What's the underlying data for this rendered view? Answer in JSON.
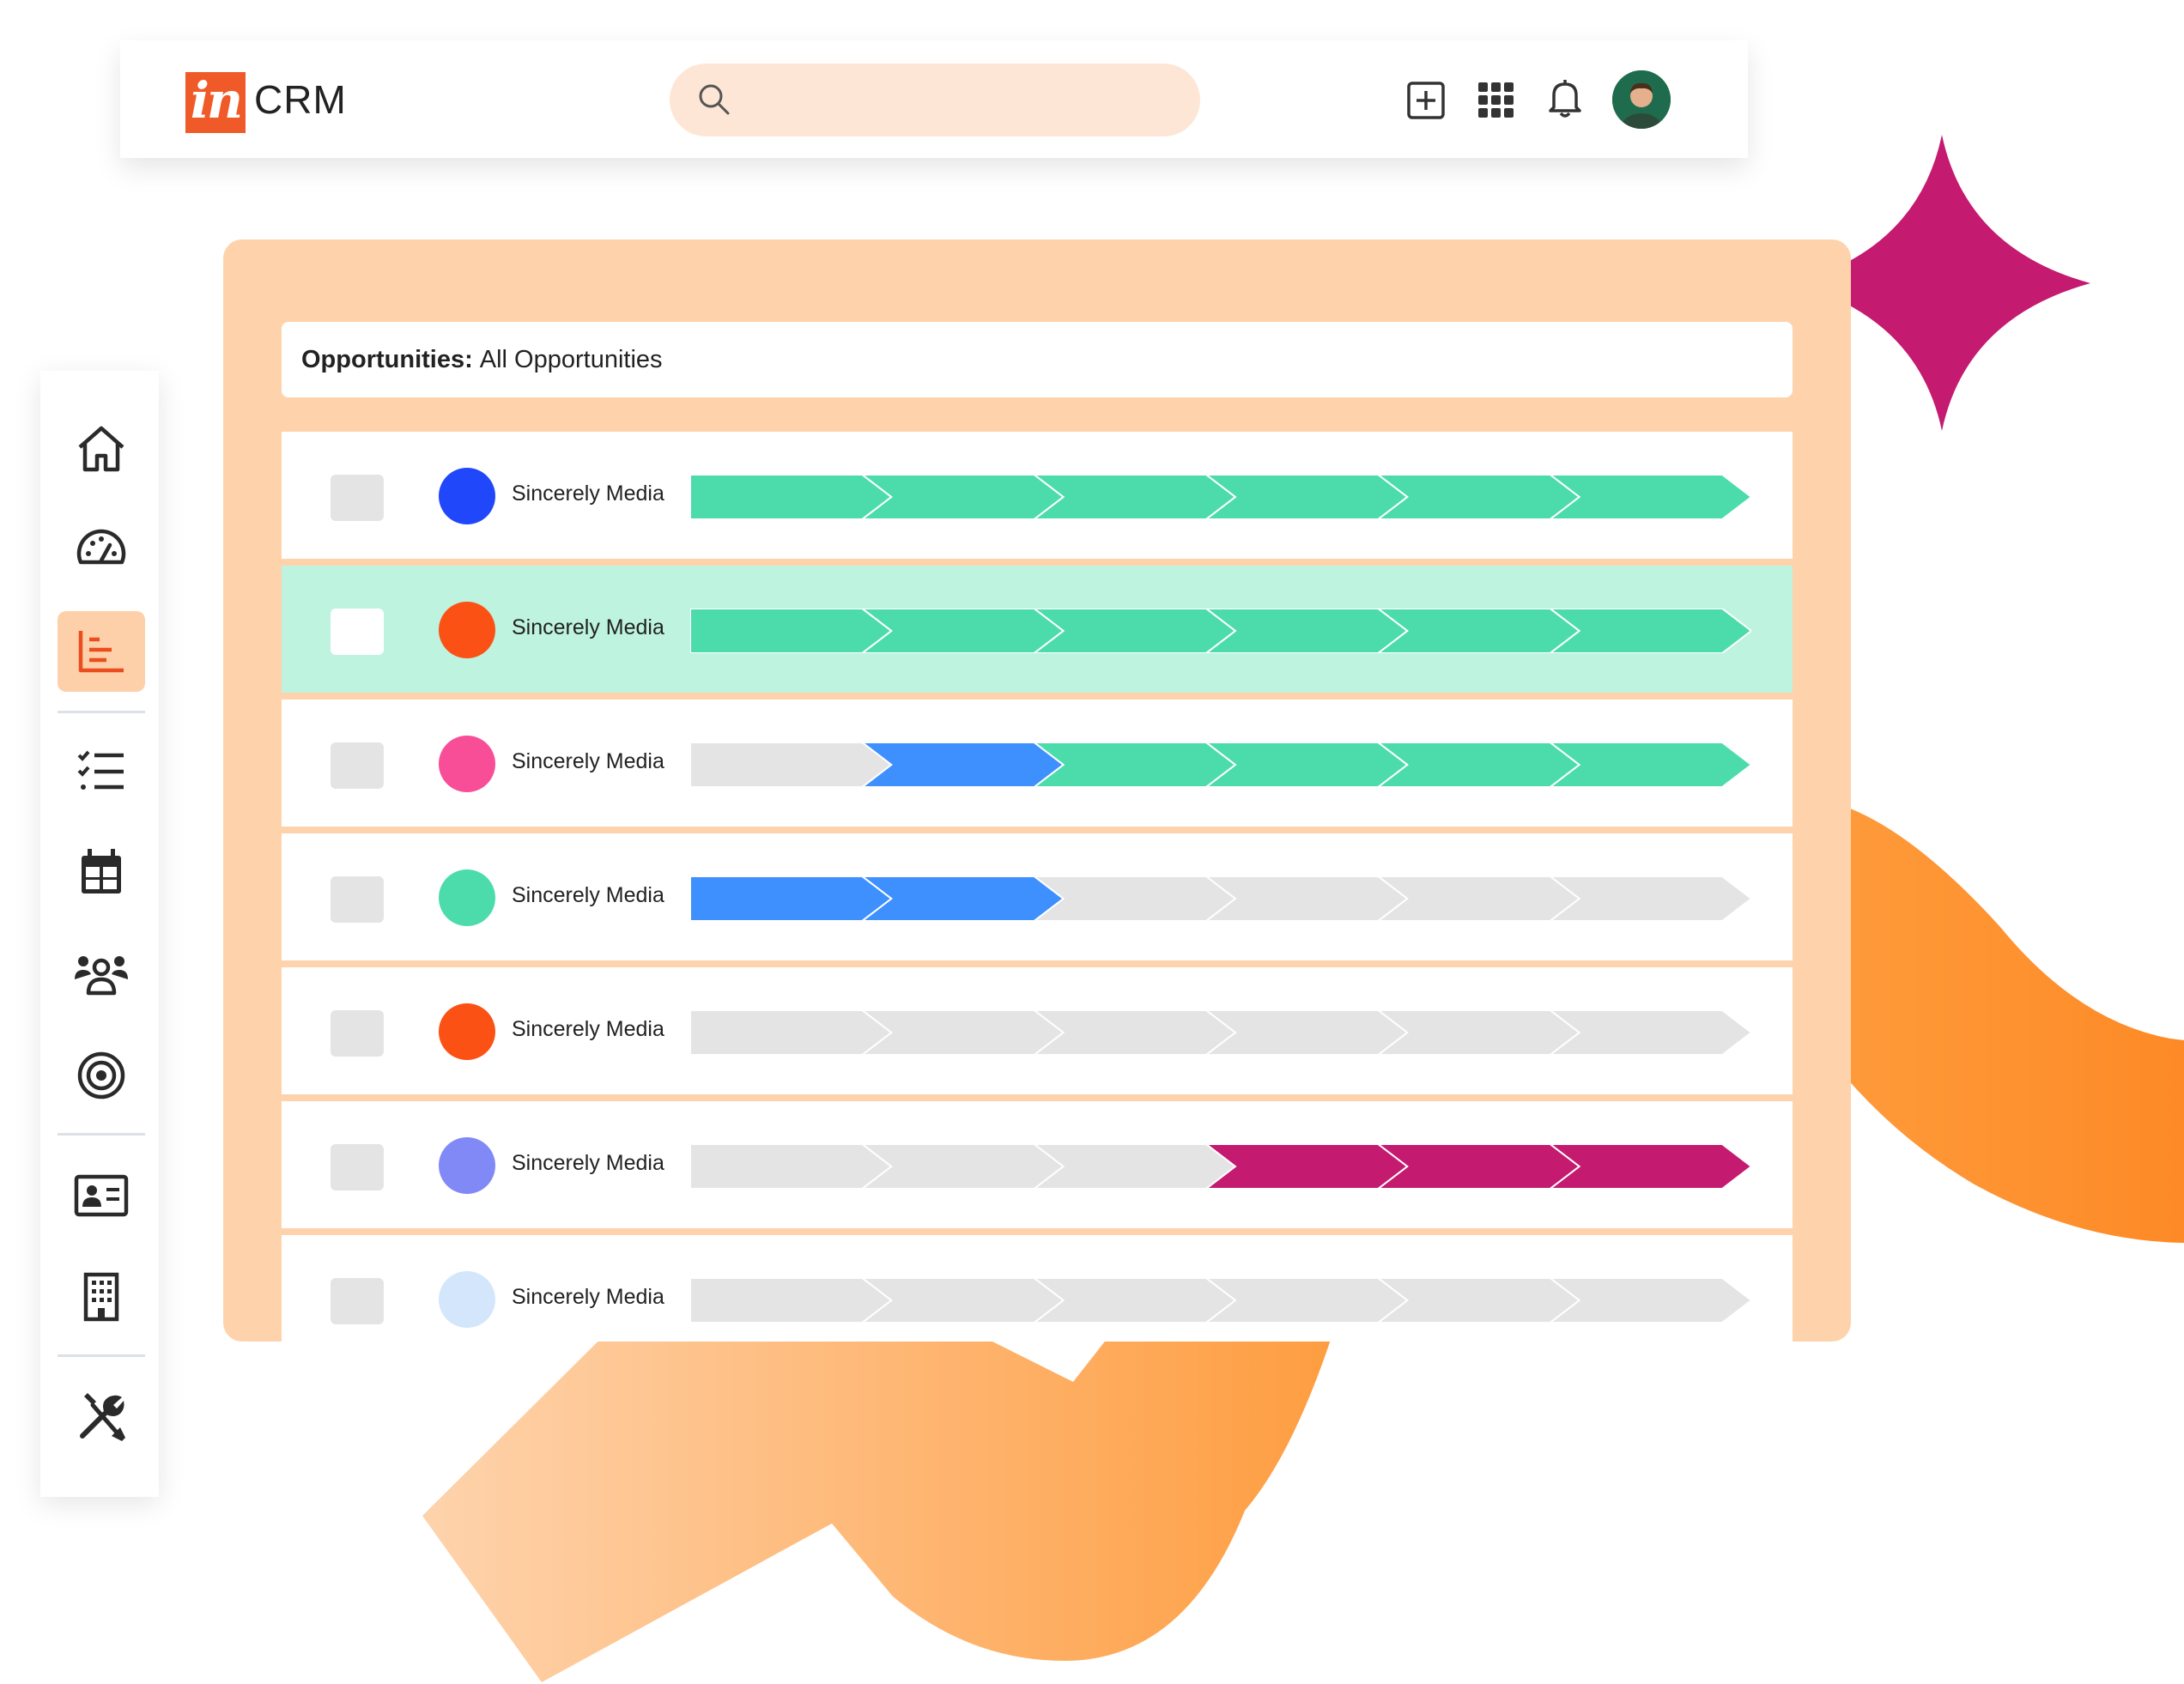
{
  "app": {
    "logo_badge": "in",
    "logo_text": "CRM",
    "brand_color": "#f05a28"
  },
  "search": {
    "placeholder": "",
    "value": "",
    "icon": "search-icon"
  },
  "toolbar_icons": [
    "add-icon",
    "apps-grid-icon",
    "bell-icon",
    "user-avatar"
  ],
  "sidebar": {
    "items": [
      {
        "icon": "home-icon",
        "active": false
      },
      {
        "icon": "dashboard-gauge-icon",
        "active": false
      },
      {
        "icon": "opportunities-chart-icon",
        "active": true
      },
      {
        "icon": "tasks-checklist-icon",
        "active": false
      },
      {
        "icon": "calendar-icon",
        "active": false
      },
      {
        "icon": "people-icon",
        "active": false
      },
      {
        "icon": "target-icon",
        "active": false
      },
      {
        "icon": "contact-card-icon",
        "active": false
      },
      {
        "icon": "company-building-icon",
        "active": false
      },
      {
        "icon": "tools-icon",
        "active": false
      }
    ]
  },
  "view": {
    "label": "Opportunities:",
    "value": "All Opportunities"
  },
  "pipeline_colors": {
    "empty": "#e4e4e4",
    "won": "#4cdcac",
    "progress": "#3d90fd",
    "lost": "#c41a6f"
  },
  "rows": [
    {
      "name": "Sincerely Media",
      "color": "#2147fb",
      "selected": false,
      "stages": [
        "won",
        "won",
        "won",
        "won",
        "won",
        "won"
      ]
    },
    {
      "name": "Sincerely Media",
      "color": "#fb5114",
      "selected": true,
      "stages": [
        "won",
        "won",
        "won",
        "won",
        "won",
        "won"
      ]
    },
    {
      "name": "Sincerely Media",
      "color": "#f84e98",
      "selected": false,
      "stages": [
        "empty",
        "progress",
        "won",
        "won",
        "won",
        "won"
      ]
    },
    {
      "name": "Sincerely Media",
      "color": "#4cdcac",
      "selected": false,
      "stages": [
        "progress",
        "progress",
        "empty",
        "empty",
        "empty",
        "empty"
      ]
    },
    {
      "name": "Sincerely Media",
      "color": "#fb5114",
      "selected": false,
      "stages": [
        "empty",
        "empty",
        "empty",
        "empty",
        "empty",
        "empty"
      ]
    },
    {
      "name": "Sincerely Media",
      "color": "#8189f7",
      "selected": false,
      "stages": [
        "empty",
        "empty",
        "empty",
        "lost",
        "lost",
        "lost"
      ]
    },
    {
      "name": "Sincerely Media",
      "color": "#d4e6fc",
      "selected": false,
      "stages": [
        "empty",
        "empty",
        "empty",
        "empty",
        "empty",
        "empty"
      ]
    }
  ]
}
